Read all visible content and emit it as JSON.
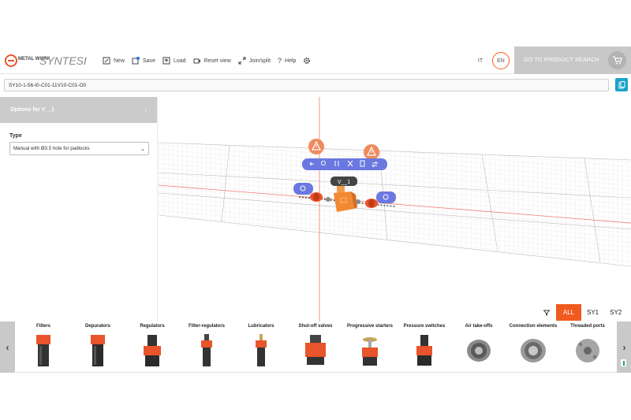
{
  "header": {
    "logo": {
      "brand_left": "METAL WORK",
      "brand_right": "SYNTESI"
    },
    "toolbar": [
      {
        "label": "New",
        "icon": "new-icon"
      },
      {
        "label": "Save",
        "icon": "save-icon"
      },
      {
        "label": "Load",
        "icon": "load-icon"
      },
      {
        "label": "Reset view",
        "icon": "camera-icon"
      },
      {
        "label": "Join/split",
        "icon": "join-split-icon"
      },
      {
        "label": "Help",
        "icon": "help-icon"
      }
    ],
    "languages": {
      "it": "IT",
      "en": "EN",
      "active": "EN"
    },
    "product_search": "GO TO PRODUCT SEARCH"
  },
  "code": {
    "value": "SY10-1-56-I0-C01-11V10-C01-O0"
  },
  "options": {
    "title": "Options for V__1",
    "type_label": "Type",
    "type_value": "Manual with Ø3.5 hole for padlocks"
  },
  "viewport": {
    "component_label": "V__1"
  },
  "filters": {
    "all": "ALL",
    "sy1": "SY1",
    "sy2": "SY2",
    "active": "ALL"
  },
  "categories": [
    {
      "label": "Filters",
      "icon": "filter-product"
    },
    {
      "label": "Depurators",
      "icon": "depurator-product"
    },
    {
      "label": "Regulators",
      "icon": "regulator-product"
    },
    {
      "label": "Filter-regulators",
      "icon": "filter-regulator-product"
    },
    {
      "label": "Lubricators",
      "icon": "lubricator-product"
    },
    {
      "label": "Shut-off valves",
      "icon": "shutoff-valve-product"
    },
    {
      "label": "Progressive starters",
      "icon": "progressive-starter-product"
    },
    {
      "label": "Pressure switches",
      "icon": "pressure-switch-product"
    },
    {
      "label": "Air take-offs",
      "icon": "air-takeoff-product"
    },
    {
      "label": "Connection elements",
      "icon": "connection-element-product"
    },
    {
      "label": "Threaded ports",
      "icon": "threaded-port-product"
    }
  ],
  "colors": {
    "accent": "#f05a1f",
    "tool_blue": "#6b78e0",
    "warning": "#f08a5d",
    "teal": "#1aa3c9",
    "grey": "#c9c9c9"
  }
}
